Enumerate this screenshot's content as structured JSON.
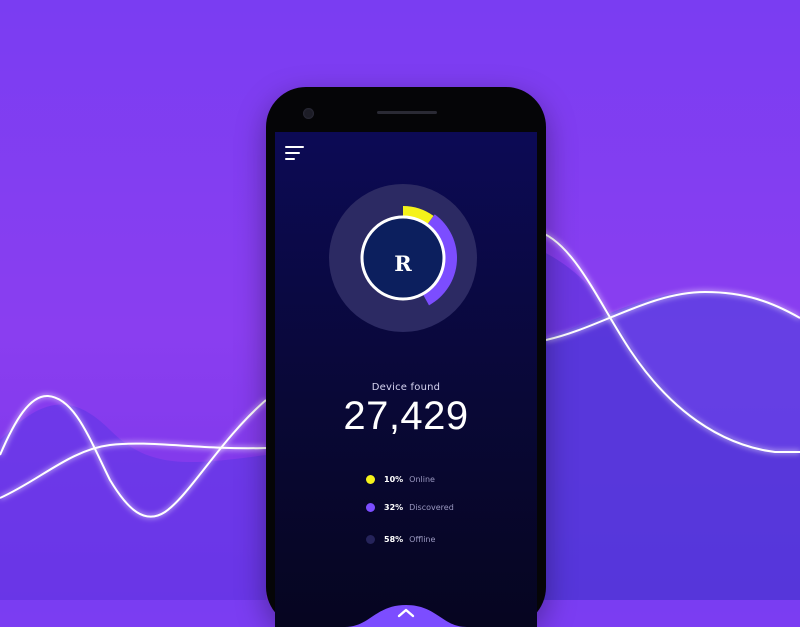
{
  "menu_icon": "hamburger-menu-icon",
  "center_letter": "R",
  "device_found": {
    "label": "Device found",
    "count": "27,429"
  },
  "stats": [
    {
      "percent": "10%",
      "label": "Online",
      "value": 10,
      "color": "#f5f21a"
    },
    {
      "percent": "32%",
      "label": "Discovered",
      "value": 32,
      "color": "#7c4dff"
    },
    {
      "percent": "58%",
      "label": "Offline",
      "value": 58,
      "color": "#25235a"
    }
  ],
  "bottom_icon": "chevron-up-icon",
  "colors": {
    "accent_purple": "#7c4dff",
    "accent_yellow": "#f5f21a",
    "screen_bg": "#0a0840",
    "background": "#7a3df2"
  }
}
